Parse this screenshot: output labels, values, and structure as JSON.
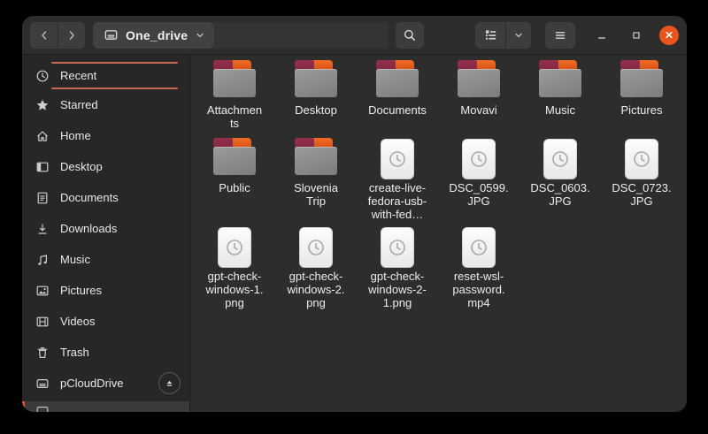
{
  "titlebar": {
    "location_button": {
      "label": "One_drive",
      "icon": "drive-icon"
    },
    "icons": [
      "back-icon",
      "forward-icon",
      "search-icon",
      "list-view-icon",
      "chevron-down-icon",
      "hamburger-menu-icon",
      "minimize-icon",
      "maximize-icon",
      "close-icon"
    ]
  },
  "sidebar": {
    "items": [
      {
        "label": "Recent",
        "icon": "recent-clock-icon"
      },
      {
        "label": "Starred",
        "icon": "star-icon"
      },
      {
        "label": "Home",
        "icon": "home-icon"
      },
      {
        "label": "Desktop",
        "icon": "desktop-icon"
      },
      {
        "label": "Documents",
        "icon": "document-icon"
      },
      {
        "label": "Downloads",
        "icon": "download-icon"
      },
      {
        "label": "Music",
        "icon": "music-note-icon"
      },
      {
        "label": "Pictures",
        "icon": "picture-icon"
      },
      {
        "label": "Videos",
        "icon": "film-icon"
      },
      {
        "label": "Trash",
        "icon": "trash-icon"
      },
      {
        "label": "pCloudDrive",
        "icon": "drive-icon",
        "has_eject_button": true
      }
    ],
    "drop_indicator_color": "#c56a4e",
    "selected_indicator_color": "#e95420"
  },
  "files": {
    "items": [
      {
        "name": "Attachments",
        "type": "folder",
        "display": "Attachmen\nts"
      },
      {
        "name": "Desktop",
        "type": "folder",
        "display": "Desktop"
      },
      {
        "name": "Documents",
        "type": "folder",
        "display": "Documents"
      },
      {
        "name": "Movavi",
        "type": "folder",
        "display": "Movavi"
      },
      {
        "name": "Music",
        "type": "folder",
        "display": "Music"
      },
      {
        "name": "Pictures",
        "type": "folder",
        "display": "Pictures"
      },
      {
        "name": "Public",
        "type": "folder",
        "display": "Public"
      },
      {
        "name": "Slovenia Trip",
        "type": "folder",
        "display": "Slovenia\nTrip"
      },
      {
        "name": "create-live-fedora-usb-with-fed…",
        "type": "file",
        "display": "create-live-\nfedora-usb-\nwith-fed…"
      },
      {
        "name": "DSC_0599.JPG",
        "type": "file",
        "display": "DSC_0599.\nJPG"
      },
      {
        "name": "DSC_0603.JPG",
        "type": "file",
        "display": "DSC_0603.\nJPG"
      },
      {
        "name": "DSC_0723.JPG",
        "type": "file",
        "display": "DSC_0723.\nJPG"
      },
      {
        "name": "gpt-check-windows-1.png",
        "type": "file",
        "display": "gpt-check-\nwindows-1.\npng"
      },
      {
        "name": "gpt-check-windows-2.png",
        "type": "file",
        "display": "gpt-check-\nwindows-2.\npng"
      },
      {
        "name": "gpt-check-windows-2-1.png",
        "type": "file",
        "display": "gpt-check-\nwindows-2-\n1.png"
      },
      {
        "name": "reset-wsl-password.mp4",
        "type": "file",
        "display": "reset-wsl-\npassword.\nmp4"
      }
    ]
  },
  "colors": {
    "window_bg": "#2d2d2d",
    "sidebar_bg": "#272727",
    "button_bg": "#3d3d3d",
    "close_button": "#e9541d",
    "folder_tab_orange": "#ef6b24",
    "folder_flap_maroon": "#8c2f4a",
    "folder_body_gray": "#8e8e8e"
  }
}
